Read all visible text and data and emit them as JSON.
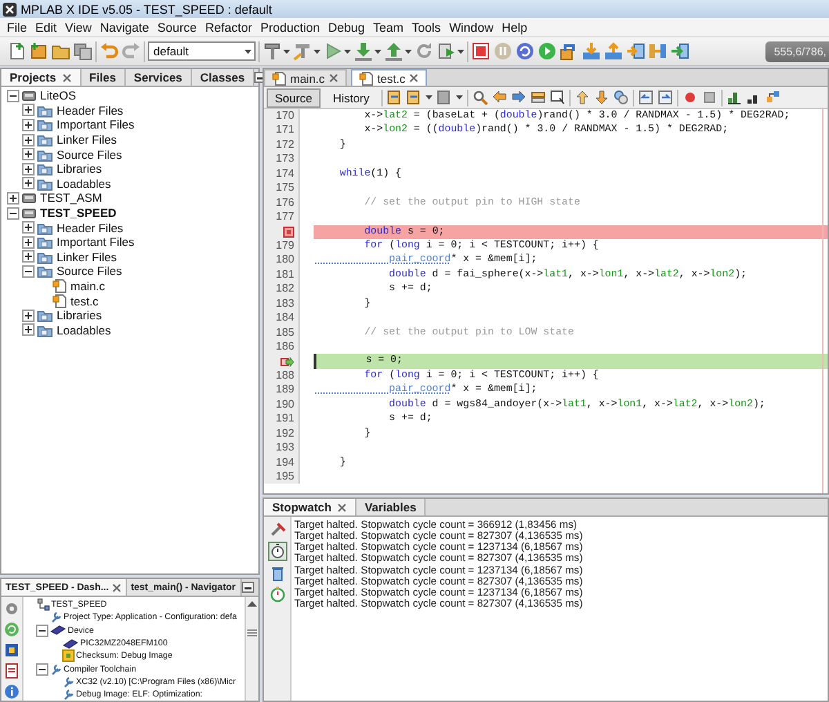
{
  "window": {
    "title": "MPLAB X IDE v5.05 - TEST_SPEED : default"
  },
  "menu": [
    "File",
    "Edit",
    "View",
    "Navigate",
    "Source",
    "Refactor",
    "Production",
    "Debug",
    "Team",
    "Tools",
    "Window",
    "Help"
  ],
  "toolbar": {
    "configuration": "default",
    "status": "555,6/786,"
  },
  "projects_panel": {
    "tabs": [
      {
        "label": "Projects",
        "selected": true
      },
      {
        "label": "Files",
        "selected": false
      },
      {
        "label": "Services",
        "selected": false
      },
      {
        "label": "Classes",
        "selected": false
      }
    ],
    "tree": [
      {
        "label": "LiteOS",
        "kind": "project",
        "main": false,
        "expanded": true,
        "children": [
          {
            "label": "Header Files",
            "kind": "folder",
            "expanded": false
          },
          {
            "label": "Important Files",
            "kind": "folder",
            "expanded": false
          },
          {
            "label": "Linker Files",
            "kind": "folder",
            "expanded": false
          },
          {
            "label": "Source Files",
            "kind": "folder",
            "expanded": false
          },
          {
            "label": "Libraries",
            "kind": "folder",
            "expanded": false
          },
          {
            "label": "Loadables",
            "kind": "folder",
            "expanded": false
          }
        ]
      },
      {
        "label": "TEST_ASM",
        "kind": "project",
        "main": false,
        "expanded": false
      },
      {
        "label": "TEST_SPEED",
        "kind": "project",
        "main": true,
        "expanded": true,
        "children": [
          {
            "label": "Header Files",
            "kind": "folder",
            "expanded": false
          },
          {
            "label": "Important Files",
            "kind": "folder",
            "expanded": false
          },
          {
            "label": "Linker Files",
            "kind": "folder",
            "expanded": false
          },
          {
            "label": "Source Files",
            "kind": "folder",
            "expanded": true,
            "children": [
              {
                "label": "main.c",
                "kind": "file"
              },
              {
                "label": "test.c",
                "kind": "file"
              }
            ]
          },
          {
            "label": "Libraries",
            "kind": "folder",
            "expanded": false
          },
          {
            "label": "Loadables",
            "kind": "folder",
            "expanded": false
          }
        ]
      }
    ]
  },
  "dashboard_panel": {
    "tabs": [
      {
        "label": "TEST_SPEED - Dash...",
        "selected": true
      },
      {
        "label": "test_main() - Navigator",
        "selected": false
      }
    ],
    "tree": [
      {
        "label": "TEST_SPEED",
        "kind": "project",
        "children": [
          {
            "label": "Project Type: Application - Configuration: defa",
            "kind": "info"
          },
          {
            "label": "Device",
            "kind": "device",
            "expanded": true,
            "children": [
              {
                "label": "PIC32MZ2048EFM100",
                "kind": "chip"
              },
              {
                "label": "Checksum: Debug Image",
                "kind": "checksum"
              }
            ]
          },
          {
            "label": "Compiler Toolchain",
            "kind": "toolchain",
            "expanded": true,
            "children": [
              {
                "label": "XC32 (v2.10) [C:\\Program Files (x86)\\Micr",
                "kind": "tool"
              },
              {
                "label": "Debug Image: ELF: Optimization:",
                "kind": "tool"
              }
            ]
          }
        ]
      }
    ]
  },
  "editor": {
    "tabs": [
      {
        "label": "main.c",
        "selected": false
      },
      {
        "label": "test.c",
        "selected": true
      }
    ],
    "views": [
      {
        "label": "Source",
        "selected": true
      },
      {
        "label": "History",
        "selected": false
      }
    ],
    "lines": [
      {
        "number": "170",
        "kind": "code",
        "tokens": [
          {
            "text": "        x->",
            "kind": "plain"
          },
          {
            "text": "lat2",
            "kind": "field"
          },
          {
            "text": " = (baseLat + (",
            "kind": "plain"
          },
          {
            "text": "double",
            "kind": "keyword"
          },
          {
            "text": ")rand() * 3.0 / RANDMAX - 1.5) * DEG2RAD;",
            "kind": "plain"
          }
        ]
      },
      {
        "number": "171",
        "kind": "code",
        "tokens": [
          {
            "text": "        x->",
            "kind": "plain"
          },
          {
            "text": "lon2",
            "kind": "field"
          },
          {
            "text": " = ((",
            "kind": "plain"
          },
          {
            "text": "double",
            "kind": "keyword"
          },
          {
            "text": ")rand() * 3.0 / RANDMAX - 1.5) * DEG2RAD;",
            "kind": "plain"
          }
        ]
      },
      {
        "number": "172",
        "kind": "code",
        "tokens": [
          {
            "text": "    }",
            "kind": "plain"
          }
        ]
      },
      {
        "number": "173",
        "kind": "code"
      },
      {
        "number": "174",
        "kind": "code",
        "tokens": [
          {
            "text": "    while",
            "kind": "keyword"
          },
          {
            "text": "(1) {",
            "kind": "plain"
          }
        ]
      },
      {
        "number": "175",
        "kind": "code"
      },
      {
        "number": "176",
        "kind": "code",
        "tokens": [
          {
            "text": "        // set the output pin to HIGH state",
            "kind": "comment"
          }
        ]
      },
      {
        "number": "177",
        "kind": "code"
      },
      {
        "kind": "breakpoint",
        "tokens": [
          {
            "text": "        double",
            "kind": "keyword"
          },
          {
            "text": " s = 0;",
            "kind": "plain"
          }
        ]
      },
      {
        "number": "179",
        "kind": "code",
        "tokens": [
          {
            "text": "        for",
            "kind": "keyword"
          },
          {
            "text": " (",
            "kind": "plain"
          },
          {
            "text": "long",
            "kind": "keyword"
          },
          {
            "text": " i = 0; i < TESTCOUNT; i++) {",
            "kind": "plain"
          }
        ]
      },
      {
        "number": "180",
        "kind": "code",
        "tokens": [
          {
            "text": "            pair_coord",
            "kind": "type"
          },
          {
            "text": "* x = &mem[i];",
            "kind": "plain"
          }
        ]
      },
      {
        "number": "181",
        "kind": "code",
        "tokens": [
          {
            "text": "            double",
            "kind": "keyword"
          },
          {
            "text": " d = fai_sphere(x->",
            "kind": "plain"
          },
          {
            "text": "lat1",
            "kind": "field"
          },
          {
            "text": ", x->",
            "kind": "plain"
          },
          {
            "text": "lon1",
            "kind": "field"
          },
          {
            "text": ", x->",
            "kind": "plain"
          },
          {
            "text": "lat2",
            "kind": "field"
          },
          {
            "text": ", x->",
            "kind": "plain"
          },
          {
            "text": "lon2",
            "kind": "field"
          },
          {
            "text": ");",
            "kind": "plain"
          }
        ]
      },
      {
        "number": "182",
        "kind": "code",
        "tokens": [
          {
            "text": "            s += d;",
            "kind": "plain"
          }
        ]
      },
      {
        "number": "183",
        "kind": "code",
        "tokens": [
          {
            "text": "        }",
            "kind": "plain"
          }
        ]
      },
      {
        "number": "184",
        "kind": "code"
      },
      {
        "number": "185",
        "kind": "code",
        "tokens": [
          {
            "text": "        // set the output pin to LOW state",
            "kind": "comment"
          }
        ]
      },
      {
        "number": "186",
        "kind": "code"
      },
      {
        "kind": "current",
        "tokens": [
          {
            "text": "        s = 0;",
            "kind": "plain"
          }
        ]
      },
      {
        "number": "188",
        "kind": "code",
        "tokens": [
          {
            "text": "        for",
            "kind": "keyword"
          },
          {
            "text": " (",
            "kind": "plain"
          },
          {
            "text": "long",
            "kind": "keyword"
          },
          {
            "text": " i = 0; i < TESTCOUNT; i++) {",
            "kind": "plain"
          }
        ]
      },
      {
        "number": "189",
        "kind": "code",
        "tokens": [
          {
            "text": "            pair_coord",
            "kind": "type"
          },
          {
            "text": "* x = &mem[i];",
            "kind": "plain"
          }
        ]
      },
      {
        "number": "190",
        "kind": "code",
        "tokens": [
          {
            "text": "            double",
            "kind": "keyword"
          },
          {
            "text": " d = wgs84_andoyer(x->",
            "kind": "plain"
          },
          {
            "text": "lat1",
            "kind": "field"
          },
          {
            "text": ", x->",
            "kind": "plain"
          },
          {
            "text": "lon1",
            "kind": "field"
          },
          {
            "text": ", x->",
            "kind": "plain"
          },
          {
            "text": "lat2",
            "kind": "field"
          },
          {
            "text": ", x->",
            "kind": "plain"
          },
          {
            "text": "lon2",
            "kind": "field"
          },
          {
            "text": ");",
            "kind": "plain"
          }
        ]
      },
      {
        "number": "191",
        "kind": "code",
        "tokens": [
          {
            "text": "            s += d;",
            "kind": "plain"
          }
        ]
      },
      {
        "number": "192",
        "kind": "code",
        "tokens": [
          {
            "text": "        }",
            "kind": "plain"
          }
        ]
      },
      {
        "number": "193",
        "kind": "code"
      },
      {
        "number": "194",
        "kind": "code",
        "tokens": [
          {
            "text": "    }",
            "kind": "plain"
          }
        ]
      },
      {
        "number": "195",
        "kind": "code"
      }
    ]
  },
  "output": {
    "tabs": [
      {
        "label": "Stopwatch",
        "selected": true
      },
      {
        "label": "Variables",
        "selected": false
      }
    ],
    "lines": [
      "Target halted. Stopwatch cycle count = 366912 (1,83456 ms)",
      "Target halted. Stopwatch cycle count = 827307 (4,136535 ms)",
      "Target halted. Stopwatch cycle count = 1237134 (6,18567 ms)",
      "Target halted. Stopwatch cycle count = 827307 (4,136535 ms)",
      "Target halted. Stopwatch cycle count = 1237134 (6,18567 ms)",
      "Target halted. Stopwatch cycle count = 827307 (4,136535 ms)",
      "Target halted. Stopwatch cycle count = 1237134 (6,18567 ms)",
      "Target halted. Stopwatch cycle count = 827307 (4,136535 ms)"
    ]
  }
}
